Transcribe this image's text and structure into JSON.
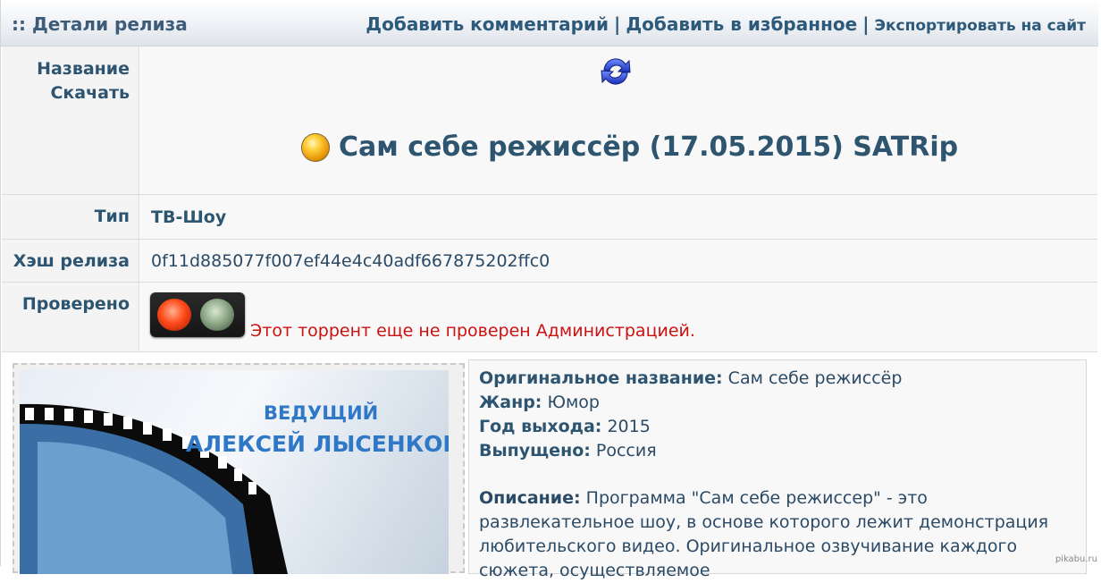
{
  "header": {
    "title": ":: Детали релиза",
    "add_comment": "Добавить комментарий",
    "add_favorite": "Добавить в избранное",
    "export_site": "Экспортировать на сайт",
    "separator": "|"
  },
  "rows": {
    "name_label": "Название",
    "download_label": "Скачать",
    "release_title": "Сам себе режиссёр (17.05.2015) SATRip",
    "type_label": "Тип",
    "type_value": "ТВ-Шоу",
    "hash_label": "Хэш релиза",
    "hash_value": "0f11d885077f007ef44e4c40adf667875202ffc0",
    "verified_label": "Проверено",
    "verified_text": "Этот торрент еще не проверен Администрацией."
  },
  "poster": {
    "line1": "ВЕДУЩИЙ",
    "line2": "АЛЕКСЕЙ ЛЫСЕНКОВ"
  },
  "info": {
    "original_label": "Оригинальное название:",
    "original_value": "Сам себе режиссёр",
    "genre_label": "Жанр:",
    "genre_value": "Юмор",
    "year_label": "Год выхода:",
    "year_value": "2015",
    "released_label": "Выпущено:",
    "released_value": "Россия",
    "desc_label": "Описание:",
    "desc_value": "Программа \"Сам себе режиссер\" - это развлекательное шоу, в основе которого лежит демонстрация любительского видео. Оригинальное озвучивание каждого сюжета, осуществляемое"
  },
  "watermark": "pikabu.ru",
  "colors": {
    "accent": "#2d5570",
    "warning": "#cc1111",
    "poster_text": "#2f78c7"
  },
  "icons": {
    "refresh": "refresh-icon",
    "orb": "status-orb-icon",
    "traffic_light": "traffic-light-icon"
  }
}
